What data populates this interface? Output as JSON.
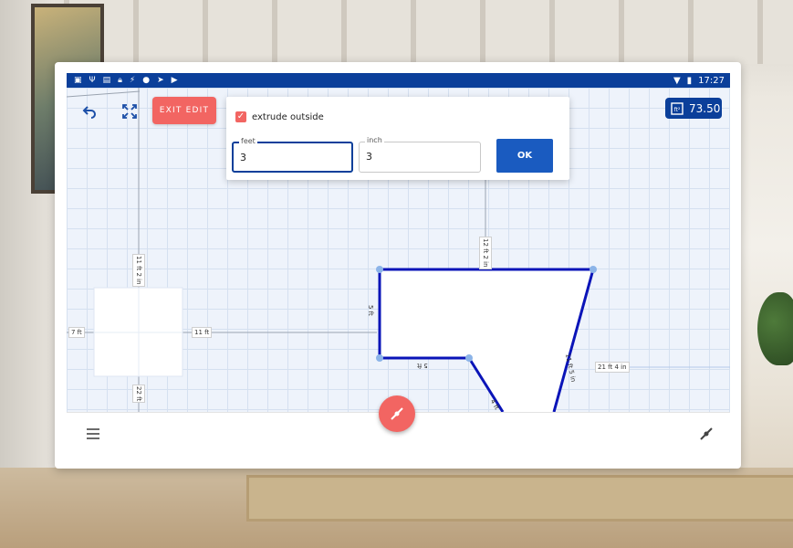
{
  "status_bar": {
    "time": "17:27",
    "left_icons": [
      "image-icon",
      "usb-icon",
      "window-icon",
      "lock-icon",
      "bolt-icon",
      "bulb-icon",
      "send-icon",
      "play-store-icon"
    ],
    "right_icons": [
      "wifi-icon",
      "battery-icon"
    ]
  },
  "toolbar": {
    "exit_edit_label": "EXIT EDIT",
    "area_value": "73.50",
    "area_icon": "area-ft-icon"
  },
  "dialog": {
    "checkbox_label": "extrude outside",
    "checkbox_checked": true,
    "feet_label": "feet",
    "feet_value": "3",
    "inch_label": "inch",
    "inch_value": "3",
    "ok_label": "OK"
  },
  "measurements": {
    "left_top": "11 ft 2 in",
    "left_left": "7 ft",
    "left_right": "11 ft",
    "left_bottom": "22 ft",
    "shape_top": "12 ft 2 in",
    "shape_left": "5 ft",
    "shape_inner": "5 ft",
    "shape_right": "11 ft 5 in",
    "shape_diag": "4 ft",
    "right_side": "21 ft 4 in"
  },
  "colors": {
    "accent": "#f26562",
    "primary": "#0b3f9a",
    "wall_line": "#0a14b8"
  }
}
